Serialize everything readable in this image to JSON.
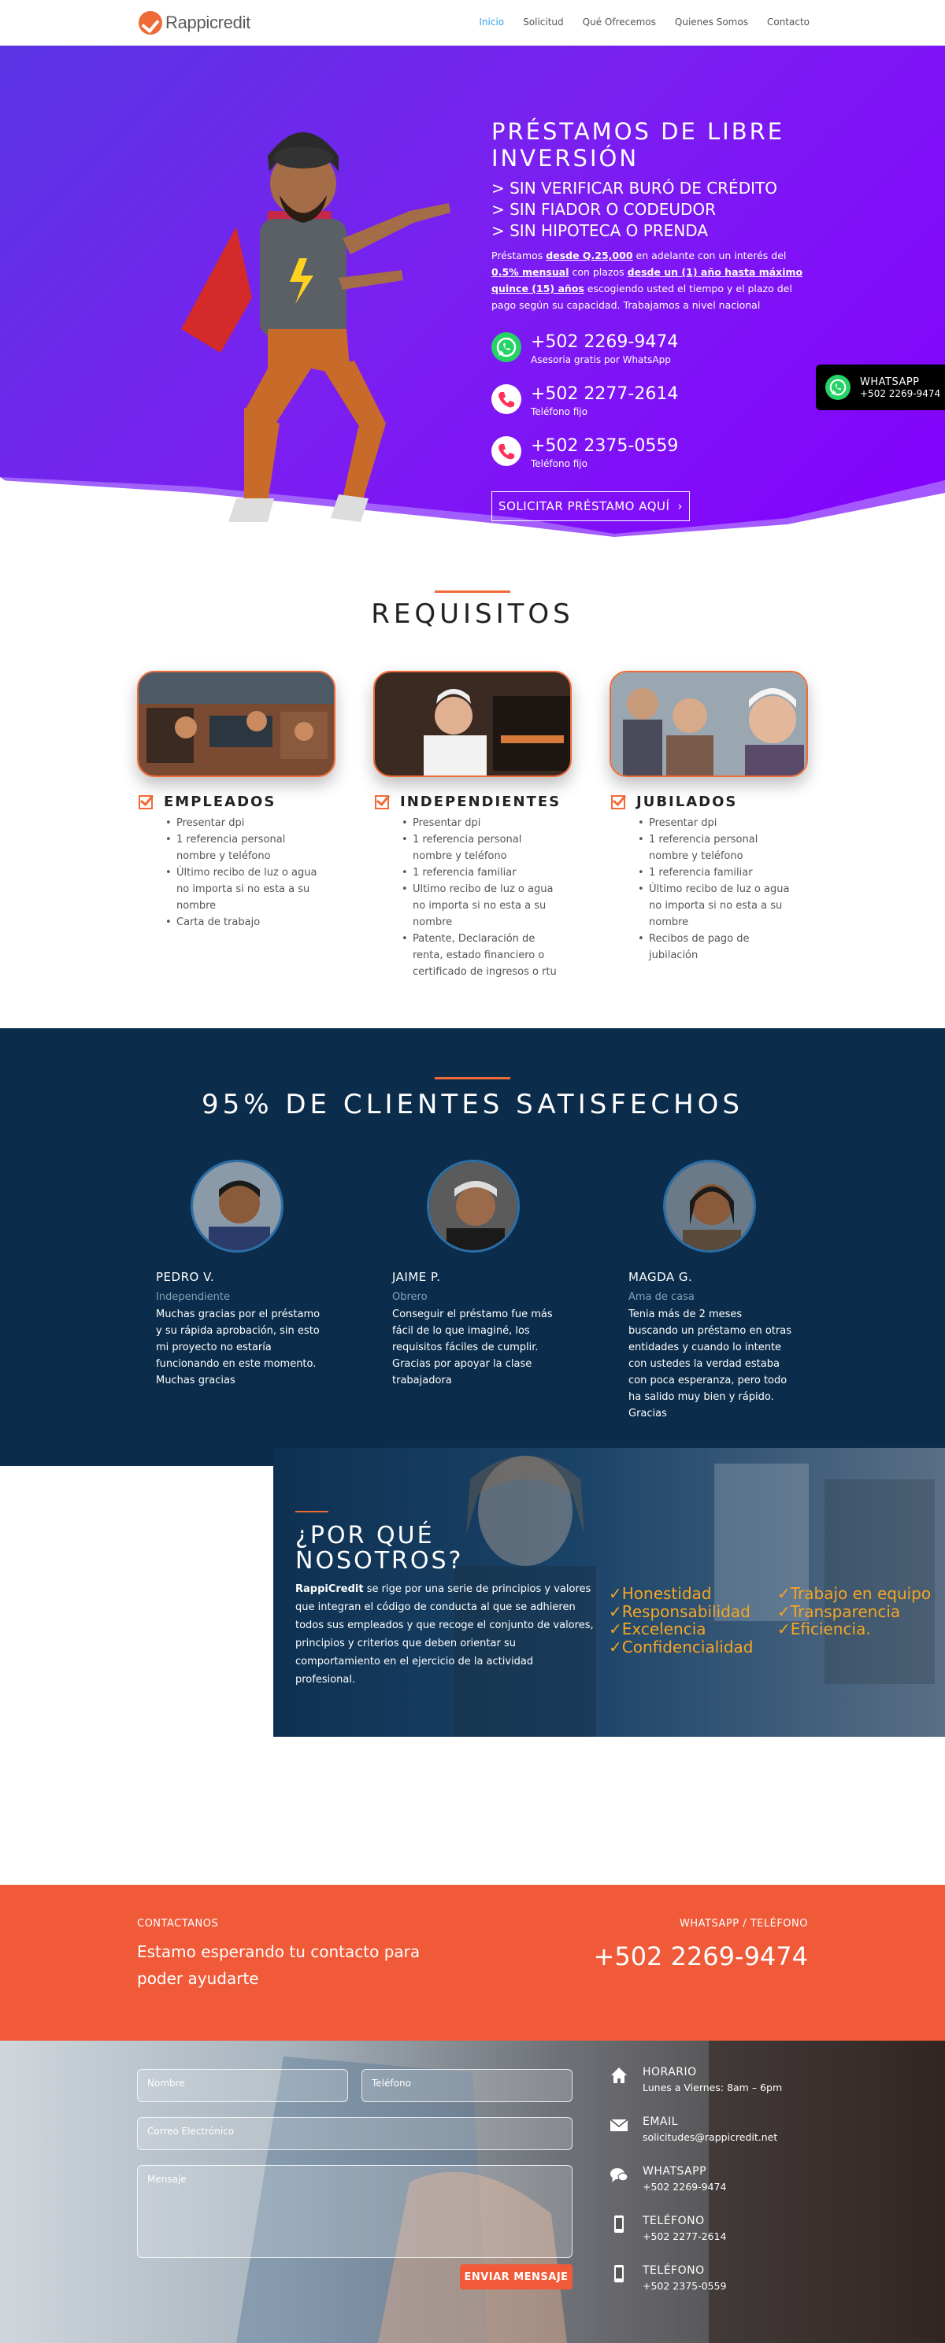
{
  "brand": {
    "name": "Rappicredit"
  },
  "nav": [
    "Inicio",
    "Solicitud",
    "Qué Ofrecemos",
    "Quienes Somos",
    "Contacto"
  ],
  "hero": {
    "title": "PRÉSTAMOS DE LIBRE INVERSIÓN",
    "bullets": [
      "> SIN VERIFICAR BURÓ DE CRÉDITO",
      "> SIN FIADOR O CODEUDOR",
      "> SIN HIPOTECA O PRENDA"
    ],
    "desc_1": "Préstamos ",
    "desc_b1": "desde Q.25,000",
    "desc_2": " en adelante con un interés del ",
    "desc_b2": "0.5% mensual",
    "desc_3": " con plazos ",
    "desc_b3": "desde un (1) año hasta máximo quince (15) años",
    "desc_4": " escogiendo usted el tiempo y el plazo del pago según su capacidad. Trabajamos a nivel nacional",
    "contacts": [
      {
        "number": "+502 2269-9474",
        "label": "Asesoria gratis por WhatsApp",
        "icon": "whatsapp-icon"
      },
      {
        "number": "+502 2277-2614",
        "label": "Teléfono fijo",
        "icon": "phone-icon"
      },
      {
        "number": "+502 2375-0559",
        "label": "Teléfono fijo",
        "icon": "phone-icon"
      }
    ],
    "cta": "SOLICITAR PRÉSTAMO AQUÍ",
    "cta_arrow": "›"
  },
  "whatsapp_float": {
    "title": "WHATSAPP",
    "number": "+502 2269-9474"
  },
  "requisitos": {
    "title": "REQUISITOS",
    "columns": [
      {
        "title": "EMPLEADOS",
        "items": [
          "Presentar dpi",
          "1 referencia personal nombre y teléfono",
          "Último recibo de luz o agua no importa si no esta a su nombre",
          "Carta de trabajo"
        ]
      },
      {
        "title": "INDEPENDIENTES",
        "items": [
          "Presentar dpi",
          "1 referencia personal nombre y teléfono",
          "1 referencia familiar",
          "Ultimo recibo de luz o agua no importa si no esta a su nombre",
          "Patente, Declaración de renta, estado financiero o certificado de ingresos o rtu"
        ]
      },
      {
        "title": "JUBILADOS",
        "items": [
          "Presentar dpi",
          "1 referencia personal nombre y teléfono",
          "1 referencia familiar",
          "Último recibo de luz o agua no importa si no esta a su nombre",
          "Recibos de pago de jubilación"
        ]
      }
    ]
  },
  "testimonials": {
    "title": "95% DE CLIENTES SATISFECHOS",
    "items": [
      {
        "name": "PEDRO V.",
        "role": "Independiente",
        "text": "Muchas gracias por el préstamo y su rápida aprobación, sin esto mi proyecto no estaría funcionando en este momento. Muchas gracias"
      },
      {
        "name": "JAIME P.",
        "role": "Obrero",
        "text": "Conseguir el préstamo fue más fácil de lo que imaginé, los requisitos fáciles de cumplir. Gracias por apoyar la clase trabajadora"
      },
      {
        "name": "MAGDA G.",
        "role": "Ama de casa",
        "text": "Tenia más de 2 meses buscando un préstamo en otras entidades y cuando lo intente con ustedes la verdad estaba con poca esperanza, pero todo ha salido muy bien y rápido. Gracias"
      }
    ]
  },
  "why": {
    "title_1": "¿POR QUÉ",
    "title_2": "NOSOTROS?",
    "brand": "RappiCredit",
    "text": " se rige por una serie de principios y valores que integran el código de conducta al que se adhieren todos sus empleados y que recoge el conjunto de valores, principios y criterios que deben orientar su comportamiento en el ejercicio de la actividad profesional.",
    "values_1": [
      "✓Honestidad",
      "✓Responsabilidad",
      "✓Excelencia",
      "✓Confidencialidad"
    ],
    "values_2": [
      "✓Trabajo en equipo",
      "✓Transparencia",
      "✓Eficiencia."
    ]
  },
  "contact_band": {
    "label": "CONTACTANOS",
    "text": "Estamo esperando tu contacto para poder ayudarte",
    "right_label": "WHATSAPP / TELÉFONO",
    "right_number": "+502 2269-9474"
  },
  "form": {
    "name_ph": "Nombre",
    "phone_ph": "Teléfono",
    "email_ph": "Correo Electrónico",
    "message_ph": "Mensaje",
    "submit": "ENVIAR MENSAJE"
  },
  "info": [
    {
      "title": "HORARIO",
      "value": "Lunes a Viernes: 8am – 6pm",
      "icon": "home-icon"
    },
    {
      "title": "EMAIL",
      "value": "solicitudes@rappicredit.net",
      "icon": "mail-icon"
    },
    {
      "title": "WHATSAPP",
      "value": "+502 2269-9474",
      "icon": "chat-icon"
    },
    {
      "title": "TELÉFONO",
      "value": "+502 2277-2614",
      "icon": "mobile-icon"
    },
    {
      "title": "TELÉFONO",
      "value": "+502 2375-0559",
      "icon": "mobile-icon"
    }
  ],
  "colors": {
    "accent": "#f05a38",
    "purple": "#8500ff",
    "navy": "#0b2c4a",
    "link": "#2ea3f2",
    "values": "#f5a623"
  }
}
